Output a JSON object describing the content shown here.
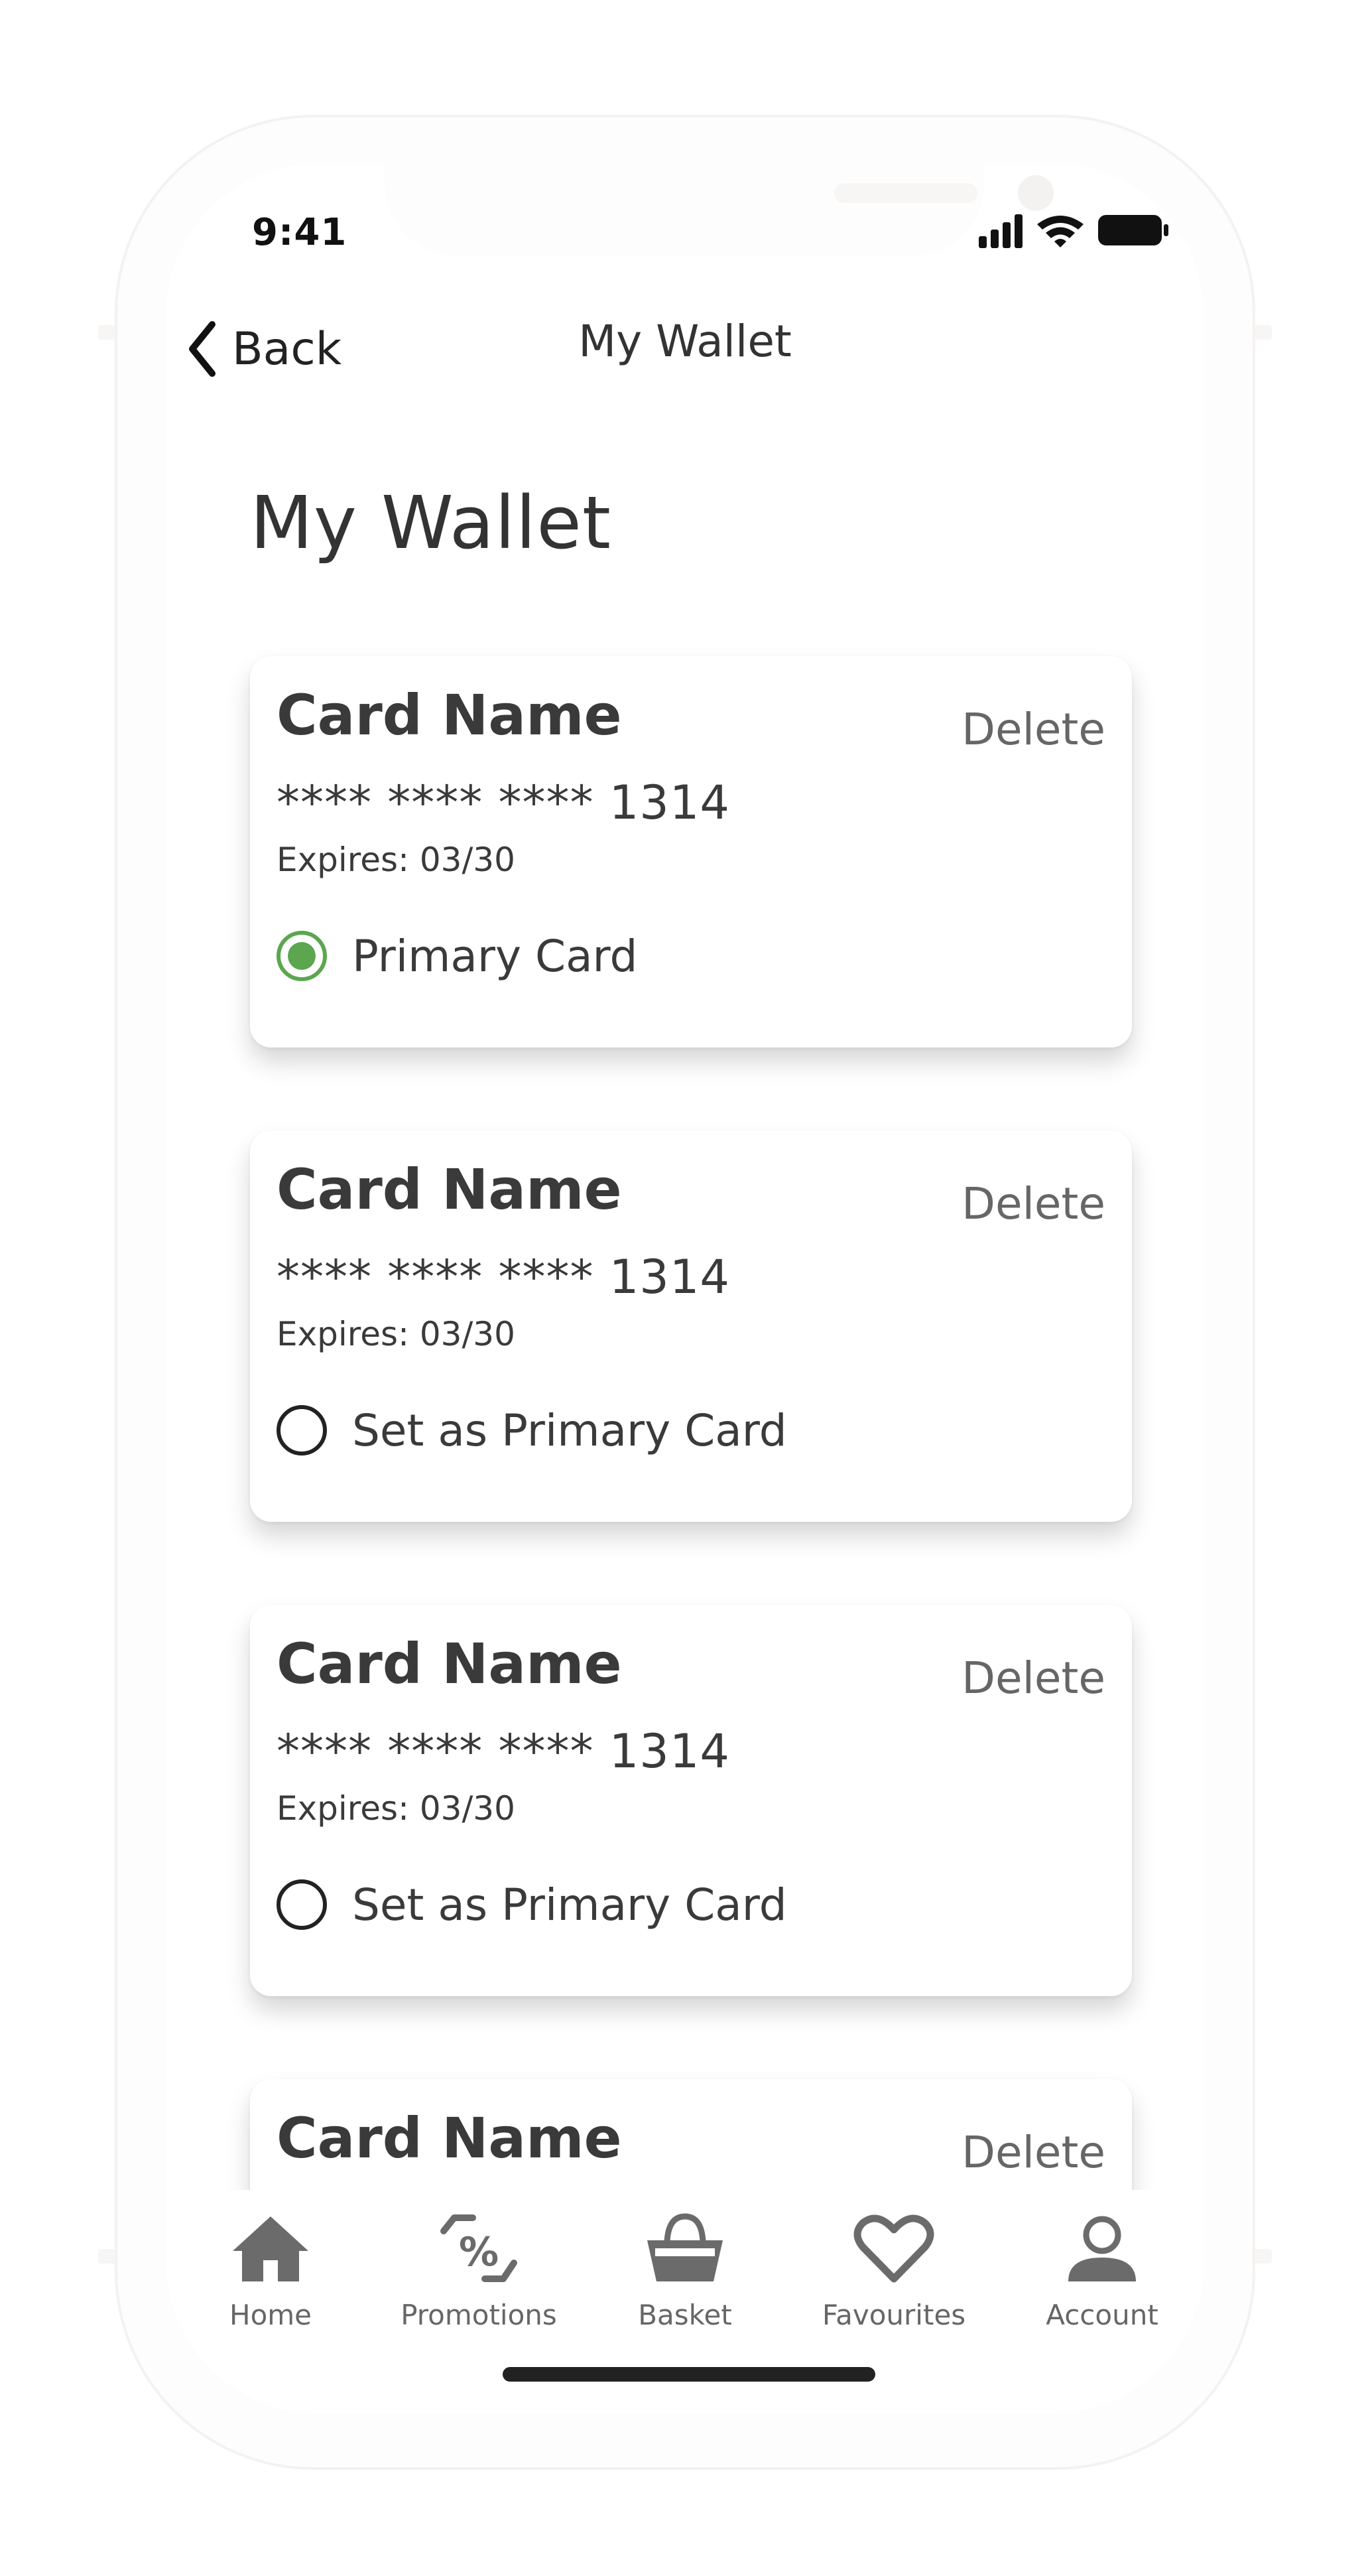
{
  "status_bar": {
    "time": "9:41",
    "icons": [
      "signal-icon",
      "wifi-icon",
      "battery-icon"
    ]
  },
  "nav": {
    "back_label": "Back",
    "title": "My Wallet"
  },
  "page": {
    "title": "My Wallet"
  },
  "cards": [
    {
      "name": "Card Name",
      "delete_label": "Delete",
      "number": "**** **** **** 1314",
      "expiry": "Expires: 03/30",
      "radio_label": "Primary Card",
      "selected": true
    },
    {
      "name": "Card Name",
      "delete_label": "Delete",
      "number": "**** **** **** 1314",
      "expiry": "Expires: 03/30",
      "radio_label": "Set as Primary Card",
      "selected": false
    },
    {
      "name": "Card Name",
      "delete_label": "Delete",
      "number": "**** **** **** 1314",
      "expiry": "Expires: 03/30",
      "radio_label": "Set as Primary Card",
      "selected": false
    },
    {
      "name": "Card Name",
      "delete_label": "Delete"
    }
  ],
  "tab_bar": {
    "items": [
      {
        "label": "Home",
        "icon": "home-icon"
      },
      {
        "label": "Promotions",
        "icon": "promotions-icon"
      },
      {
        "label": "Basket",
        "icon": "basket-icon"
      },
      {
        "label": "Favourites",
        "icon": "heart-icon"
      },
      {
        "label": "Account",
        "icon": "account-icon"
      }
    ]
  },
  "colors": {
    "accent_green": "#5ba64f",
    "text_dark": "#3a3a3a",
    "text_muted": "#666666",
    "icon_gray": "#6b6b6b"
  }
}
